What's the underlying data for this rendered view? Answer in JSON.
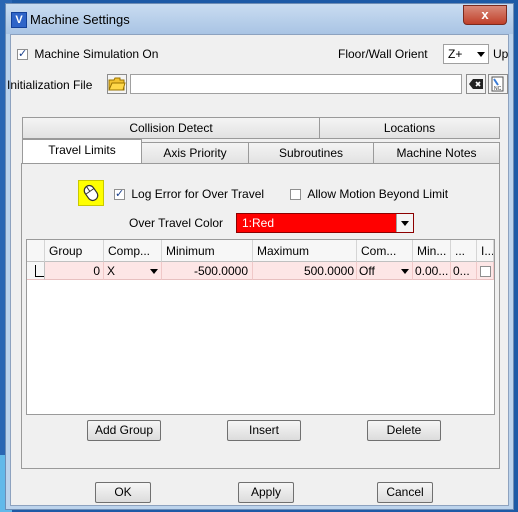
{
  "window": {
    "title": "Machine Settings",
    "close_label": "x"
  },
  "top": {
    "machine_sim_label": "Machine Simulation On",
    "machine_sim_checked": true,
    "orient_label": "Floor/Wall Orient",
    "orient_value": "Z+",
    "up_label": "Up",
    "init_file_label": "Initialization File",
    "init_file_value": ""
  },
  "tabs": {
    "row1": [
      "Collision Detect",
      "Locations"
    ],
    "row2": [
      "Travel Limits",
      "Axis Priority",
      "Subroutines",
      "Machine Notes"
    ],
    "active": "Travel Limits"
  },
  "travel": {
    "log_error_label": "Log Error for Over Travel",
    "log_error_checked": true,
    "allow_motion_label": "Allow Motion Beyond Limit",
    "allow_motion_checked": false,
    "over_travel_color_label": "Over Travel Color",
    "over_travel_color_value": "1:Red",
    "over_travel_color_hex": "#ff0000"
  },
  "grid": {
    "headers": [
      "Group",
      "Comp...",
      "Minimum",
      "Maximum",
      "Com...",
      "Min...",
      "...",
      "I..."
    ],
    "rows": [
      {
        "group": "0",
        "comp": "X",
        "minimum": "-500.0000",
        "maximum": "500.0000",
        "com": "Off",
        "min": "0.00...",
        "extra": "0...",
        "checked": false
      }
    ]
  },
  "panel_buttons": {
    "add_group": "Add Group",
    "insert": "Insert",
    "delete": "Delete"
  },
  "footer": {
    "ok": "OK",
    "apply": "Apply",
    "cancel": "Cancel"
  }
}
